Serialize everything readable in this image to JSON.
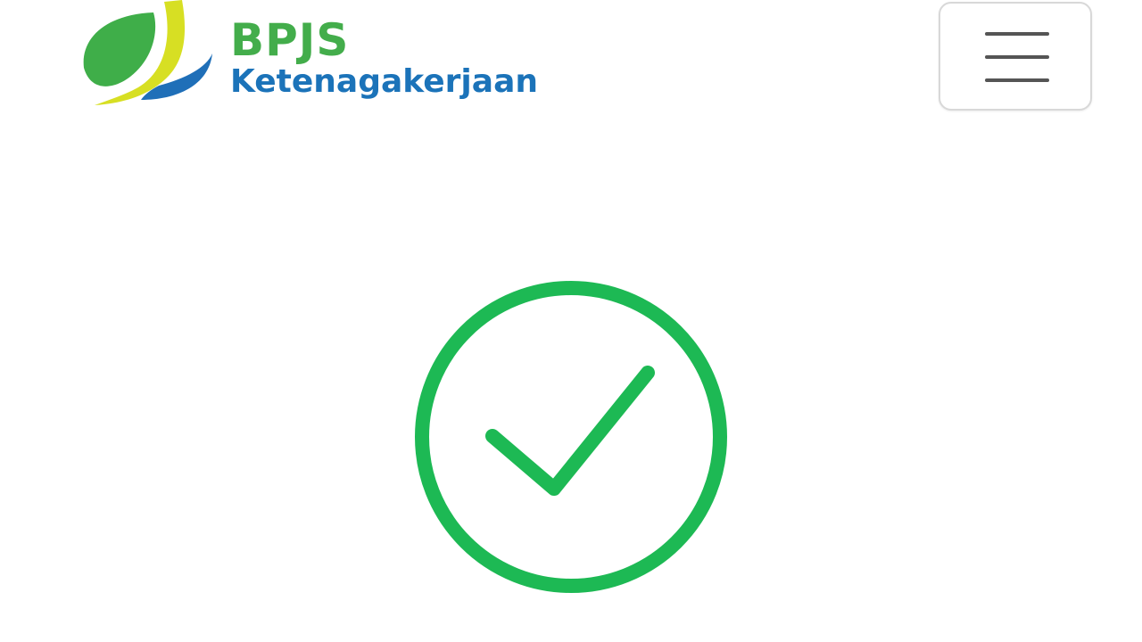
{
  "brand": {
    "name_line1": "BPJS",
    "name_line2": "Ketenagakerjaan",
    "colors": {
      "green": "#3fae49",
      "blue": "#1f6fb8",
      "yellow": "#d7df23",
      "text_green": "#43ad4b",
      "text_blue": "#1b73b9"
    }
  },
  "header": {
    "menu_icon": "hamburger-menu-icon"
  },
  "status": {
    "icon": "check-circle-icon",
    "color": "#1db954"
  }
}
